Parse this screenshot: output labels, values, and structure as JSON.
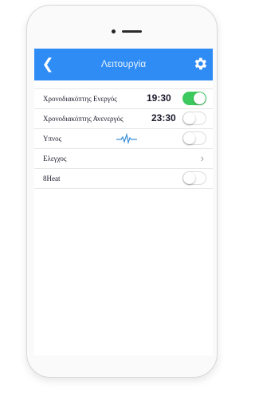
{
  "colors": {
    "nav_bar": "#2f8cf5",
    "toggle_on": "#3cc95d",
    "pulse": "#3a8fd9"
  },
  "navbar": {
    "back_icon": "chevron-left-icon",
    "title": "Λειτουργία",
    "settings_icon": "gear-icon"
  },
  "rows": [
    {
      "label": "Χρονοδιακόπτης Ενεργός",
      "time": "19:30",
      "toggle_on": true
    },
    {
      "label": "Χρονοδιακόπτης Ανενεργός",
      "time": "23:30",
      "toggle_on": false
    },
    {
      "label": "Υπνος",
      "icon": "heartbeat-pulse-icon",
      "toggle_on": false
    },
    {
      "label": "Ελεγχος",
      "icon": "chevron-right-icon"
    },
    {
      "label": "8Heat",
      "toggle_on": false
    }
  ]
}
